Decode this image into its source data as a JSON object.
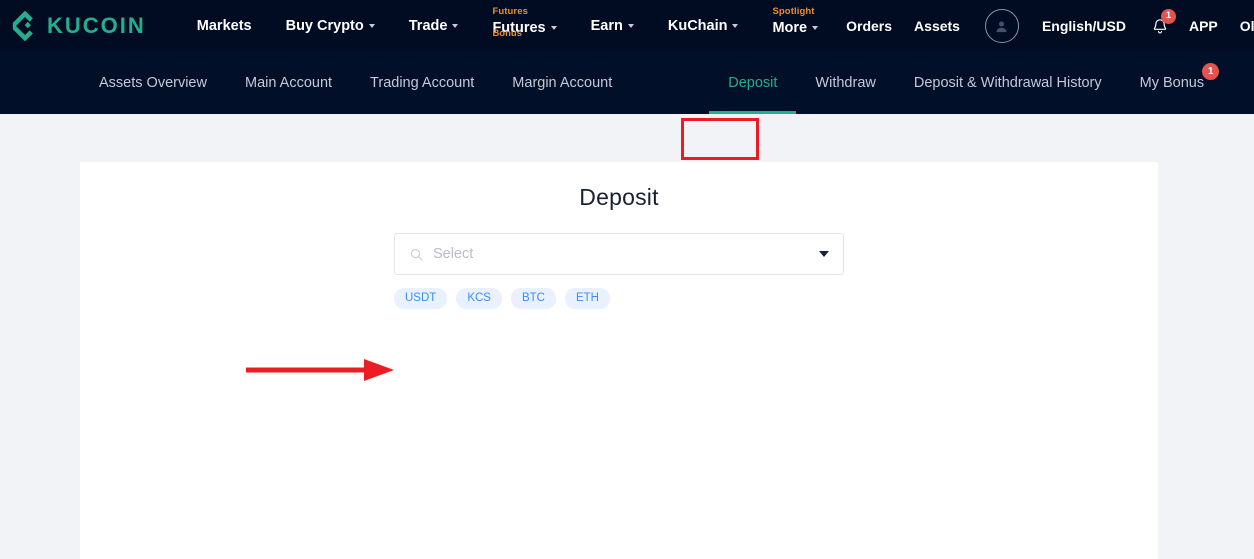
{
  "header": {
    "logo_text": "KUCOIN",
    "nav": [
      {
        "label": "Markets",
        "caret": false,
        "tag": "",
        "subtag": ""
      },
      {
        "label": "Buy Crypto",
        "caret": true,
        "tag": "",
        "subtag": ""
      },
      {
        "label": "Trade",
        "caret": true,
        "tag": "",
        "subtag": ""
      },
      {
        "label": "Futures",
        "caret": true,
        "tag": "Futures",
        "subtag": "Bonus"
      },
      {
        "label": "Earn",
        "caret": true,
        "tag": "",
        "subtag": ""
      },
      {
        "label": "KuChain",
        "caret": true,
        "tag": "",
        "subtag": ""
      },
      {
        "label": "More",
        "caret": true,
        "tag": "Spotlight",
        "subtag": ""
      }
    ],
    "right": {
      "orders": "Orders",
      "assets": "Assets",
      "language": "English/USD",
      "app": "APP",
      "old_version": "Old Version",
      "bell_badge": "1"
    }
  },
  "subnav": {
    "items": [
      {
        "label": "Assets Overview",
        "active": false,
        "badge": ""
      },
      {
        "label": "Main Account",
        "active": false,
        "badge": ""
      },
      {
        "label": "Trading Account",
        "active": false,
        "badge": ""
      },
      {
        "label": "Margin Account",
        "active": false,
        "badge": ""
      },
      {
        "label": "Deposit",
        "active": true,
        "badge": ""
      },
      {
        "label": "Withdraw",
        "active": false,
        "badge": ""
      },
      {
        "label": "Deposit & Withdrawal History",
        "active": false,
        "badge": ""
      },
      {
        "label": "My Bonus",
        "active": false,
        "badge": "1"
      }
    ]
  },
  "main": {
    "title": "Deposit",
    "select_placeholder": "Select",
    "chips": [
      "USDT",
      "KCS",
      "BTC",
      "ETH"
    ]
  },
  "colors": {
    "brand_teal": "#24ae8f",
    "header_navy": "#010b21",
    "subnav_navy": "#020f28",
    "page_bg": "#f2f3f7",
    "annotation_red": "#ec1c24",
    "chip_bg": "#e8f1fd",
    "chip_text": "#3e8cf5",
    "badge_red": "#e2544d",
    "tag_orange": "#f08c28"
  }
}
